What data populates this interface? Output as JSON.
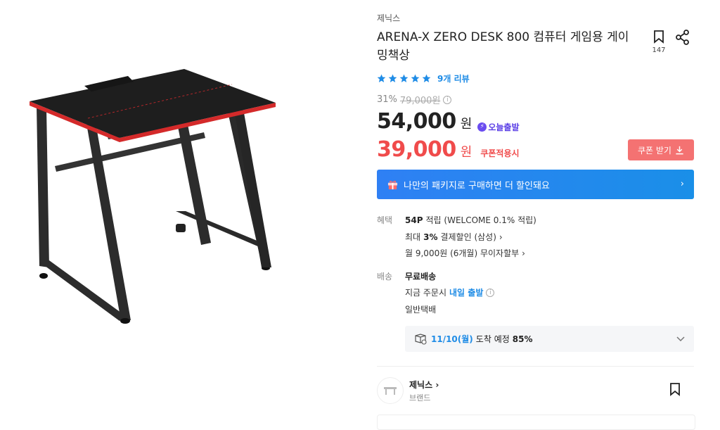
{
  "product": {
    "brand": "제닉스",
    "title": "ARENA-X ZERO DESK 800 컴퓨터 게임용 게이밍책상",
    "bookmark_count": "147",
    "rating_stars": 5,
    "review_text": "9개 리뷰"
  },
  "pricing": {
    "discount_rate": "31%",
    "original_price": "79,000원",
    "sale_price": "54,000",
    "currency": "원",
    "today_badge": "오늘출발",
    "coupon_price": "39,000",
    "coupon_label": "쿠폰적용시",
    "coupon_button": "쿠폰 받기"
  },
  "banner": {
    "text": "나만의 패키지로 구매하면 더 할인돼요"
  },
  "benefits": {
    "label": "혜택",
    "points_amount": "54P",
    "points_text": "적립 (WELCOME 0.1% 적립)",
    "card_prefix": "최대",
    "card_rate": "3%",
    "card_text": "결제할인 (삼성)",
    "installment_text": "월 9,000원 (6개월) 무이자할부"
  },
  "shipping": {
    "label": "배송",
    "fee_text": "무료배송",
    "order_prefix": "지금 주문시",
    "order_highlight": "내일 출발",
    "method": "일반택배",
    "eta_date": "11/10(월)",
    "eta_text": "도착 예정",
    "eta_rate": "85%"
  },
  "seller": {
    "name": "제닉스",
    "sub": "브랜드"
  },
  "colors": {
    "accent_blue": "#1f8ce6",
    "price_red": "#f04b4b",
    "coupon_btn": "#f47272",
    "banner_blue": "#2585f0"
  },
  "icons": [
    "bookmark-icon",
    "share-icon",
    "star-icon",
    "info-icon",
    "bolt-icon",
    "download-icon",
    "gift-icon",
    "chevron-right-icon",
    "truck-icon",
    "chevron-down-icon"
  ]
}
